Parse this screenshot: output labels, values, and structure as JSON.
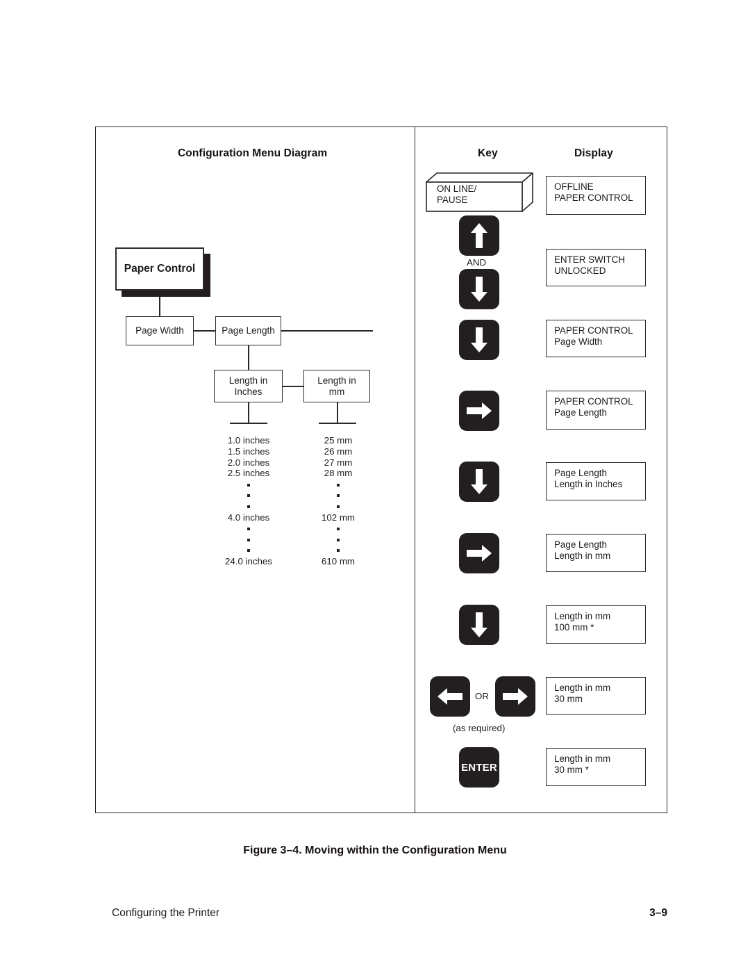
{
  "figure": {
    "caption": "Figure 3–4. Moving within the Configuration Menu",
    "diagram_heading": "Configuration Menu Diagram",
    "key_heading": "Key",
    "display_heading": "Display"
  },
  "footer": {
    "left": "Configuring the Printer",
    "page_number": "3–9"
  },
  "menu_tree": {
    "root": "Paper Control",
    "level2": {
      "page_width": "Page Width",
      "page_length": "Page Length"
    },
    "level3": {
      "length_in_inches": "Length in\nInches",
      "length_in_inches_line1": "Length in",
      "length_in_inches_line2": "Inches",
      "length_in_mm_line1": "Length in",
      "length_in_mm_line2": "mm"
    },
    "inches_values": {
      "head": [
        "1.0 inches",
        "1.5 inches",
        "2.0 inches",
        "2.5 inches"
      ],
      "middle": [
        "4.0 inches"
      ],
      "tail": [
        "24.0 inches"
      ]
    },
    "mm_values": {
      "head": [
        "25 mm",
        "26 mm",
        "27 mm",
        "28 mm"
      ],
      "middle": [
        "102 mm"
      ],
      "tail": [
        "610 mm"
      ]
    }
  },
  "steps": [
    {
      "key_type": "isometric",
      "key_label_line1": "ON LINE/",
      "key_label_line2": "PAUSE",
      "display_line1": "OFFLINE",
      "display_line2": "PAPER CONTROL"
    },
    {
      "key_type": "up-and-down",
      "conjunction": "AND",
      "display_line1": "ENTER SWITCH",
      "display_line2": "UNLOCKED"
    },
    {
      "key_type": "down",
      "display_line1": "PAPER CONTROL",
      "display_line2": "Page Width"
    },
    {
      "key_type": "right",
      "display_line1": "PAPER CONTROL",
      "display_line2": "Page Length"
    },
    {
      "key_type": "down",
      "display_line1": "Page Length",
      "display_line2": "Length in Inches"
    },
    {
      "key_type": "right",
      "display_line1": "Page Length",
      "display_line2": "Length in mm"
    },
    {
      "key_type": "down",
      "display_line1": "Length in mm",
      "display_line2": "100 mm *"
    },
    {
      "key_type": "left-or-right",
      "conjunction": "OR",
      "note": "(as required)",
      "display_line1": "Length in mm",
      "display_line2": "30 mm"
    },
    {
      "key_type": "enter",
      "key_label": "ENTER",
      "display_line1": "Length in mm",
      "display_line2": "30 mm *"
    }
  ],
  "colors": {
    "ink": "#1d1a1b",
    "key_fill": "#231e20",
    "paper": "#ffffff"
  }
}
